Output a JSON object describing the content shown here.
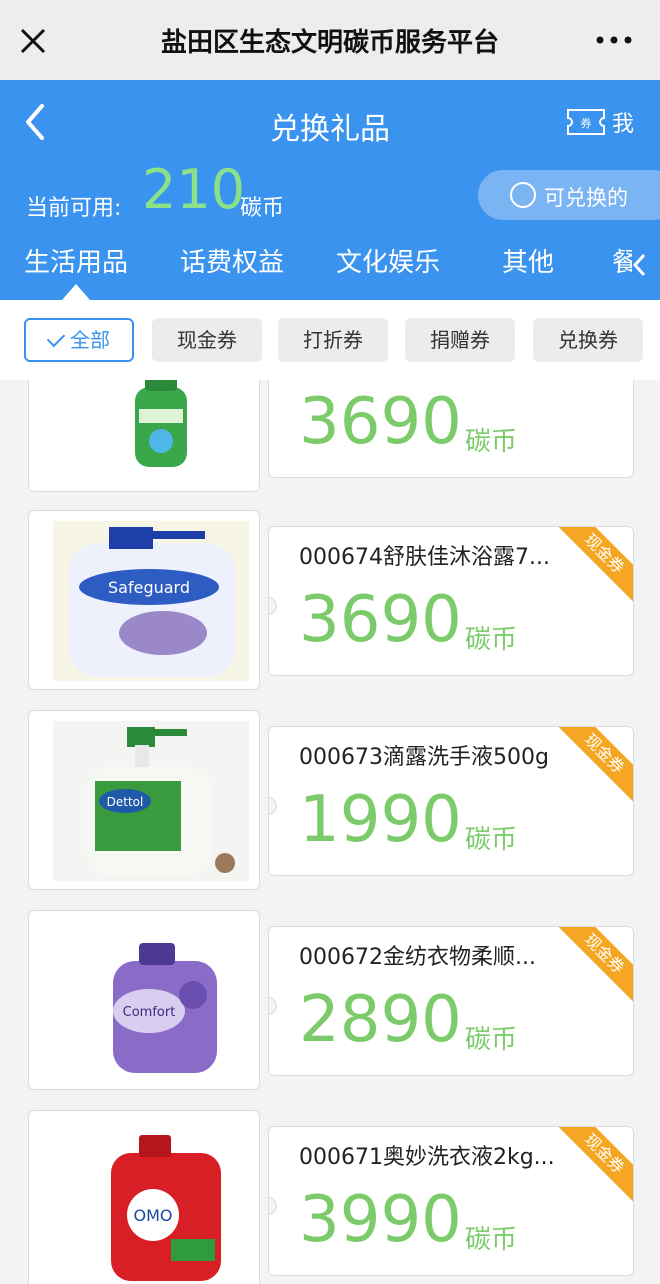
{
  "wechat": {
    "title": "盐田区生态文明碳币服务平台"
  },
  "header": {
    "title": "兑换礼品",
    "me_label": "我",
    "available_label": "当前可用:",
    "available_value": "210",
    "available_unit": "碳币",
    "exchangeable_label": "可兑换的"
  },
  "categories": [
    "生活用品",
    "话费权益",
    "文化娱乐",
    "其他",
    "餐"
  ],
  "filters": [
    "全部",
    "现金券",
    "打折券",
    "捐赠券",
    "兑换券"
  ],
  "products": [
    {
      "name": "",
      "price": "3690",
      "unit": "碳币",
      "badge": "",
      "icon": "shampoo-bottle-green"
    },
    {
      "name": "000674舒肤佳沐浴露7...",
      "price": "3690",
      "unit": "碳币",
      "badge": "现金券",
      "icon": "body-wash-bottle"
    },
    {
      "name": "000673滴露洗手液500g",
      "price": "1990",
      "unit": "碳币",
      "badge": "现金券",
      "icon": "hand-wash-bottle"
    },
    {
      "name": "000672金纺衣物柔顺...",
      "price": "2890",
      "unit": "碳币",
      "badge": "现金券",
      "icon": "softener-bottle"
    },
    {
      "name": "000671奥妙洗衣液2kg...",
      "price": "3990",
      "unit": "碳币",
      "badge": "现金券",
      "icon": "detergent-bottle"
    }
  ],
  "colors": {
    "header_blue": "#3a93ee",
    "price_green": "#7ccb6a",
    "badge_orange": "#f5a623"
  }
}
